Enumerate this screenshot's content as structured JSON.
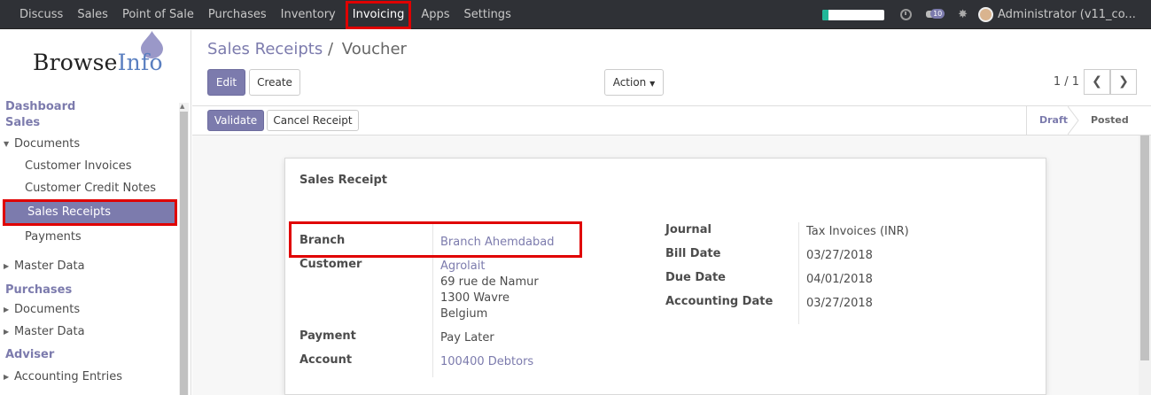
{
  "topbar": {
    "menu": [
      "Discuss",
      "Sales",
      "Point of Sale",
      "Purchases",
      "Inventory",
      "Invoicing",
      "Apps",
      "Settings"
    ],
    "active_menu": "Invoicing",
    "progress": 0.1,
    "chat_count": "10",
    "user": "Administrator (v11_co..."
  },
  "logo": {
    "brand_a": "Browse",
    "brand_b": "Info"
  },
  "sidebar": {
    "dashboard": "Dashboard",
    "sales": "Sales",
    "documents": "Documents",
    "customer_invoices": "Customer Invoices",
    "customer_credit_notes": "Customer Credit Notes",
    "sales_receipts": "Sales Receipts",
    "payments": "Payments",
    "master_data": "Master Data",
    "purchases": "Purchases",
    "purchases_documents": "Documents",
    "purchases_master_data": "Master Data",
    "adviser": "Adviser",
    "accounting_entries": "Accounting Entries"
  },
  "breadcrumb": {
    "parent": "Sales Receipts",
    "sep": "/",
    "current": "Voucher"
  },
  "buttons": {
    "edit": "Edit",
    "create": "Create",
    "action": "Action",
    "validate": "Validate",
    "cancel_receipt": "Cancel Receipt"
  },
  "pager": {
    "text": "1 / 1"
  },
  "stages": {
    "draft": "Draft",
    "posted": "Posted"
  },
  "form": {
    "title": "Sales Receipt",
    "branch_label": "Branch",
    "branch_value": "Branch Ahemdabad",
    "customer_label": "Customer",
    "customer_name": "Agrolait",
    "customer_addr1": "69 rue de Namur",
    "customer_addr2": "1300 Wavre",
    "customer_addr3": "Belgium",
    "payment_label": "Payment",
    "payment_value": "Pay Later",
    "account_label": "Account",
    "account_value": "100400 Debtors",
    "journal_label": "Journal",
    "journal_value": "Tax Invoices (INR)",
    "bill_date_label": "Bill Date",
    "bill_date_value": "03/27/2018",
    "due_date_label": "Due Date",
    "due_date_value": "04/01/2018",
    "accounting_date_label": "Accounting Date",
    "accounting_date_value": "03/27/2018"
  },
  "colors": {
    "primary": "#7c7bad",
    "topbar": "#2f3136",
    "highlight": "#e00000"
  }
}
